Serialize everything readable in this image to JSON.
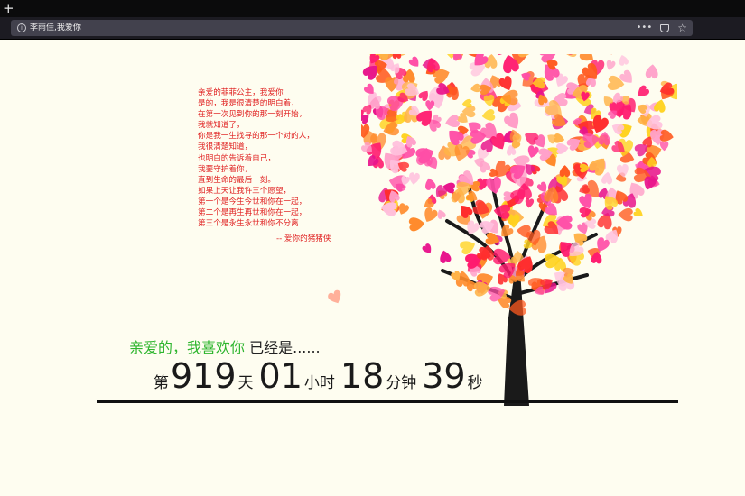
{
  "browser": {
    "new_tab_icon": "plus-icon",
    "url": "李雨佳,我爱你",
    "icons": [
      "info-icon",
      "more-dots-icon",
      "pocket-icon",
      "star-icon"
    ]
  },
  "poem": {
    "lines": [
      "亲爱的菲菲公主，我爱你",
      "是的，我是很清楚的明白着，",
      "在第一次见到你的那一刻开始，",
      "我就知道了，",
      "你是我一生找寻的那一个对的人，",
      "我很清楚知道，",
      "也明白的告诉着自己，",
      "我要守护着你，",
      "直到生命的最后一刻。",
      "如果上天让我许三个愿望，",
      "第一个是今生今世和你在一起，",
      "第二个是再生再世和你在一起，",
      "第三个是永生永世和你不分离"
    ],
    "signature": "-- 爱你的猪猪侠",
    "color": "#e02020"
  },
  "greeting": {
    "green_text": "亲爱的，我喜欢你",
    "rest_text": "已经是......",
    "green_color": "#2db52d"
  },
  "counter": {
    "prefix": "第",
    "days": "919",
    "days_label": "天",
    "hours": "01",
    "hours_label": "小时",
    "minutes": "18",
    "minutes_label": "分钟",
    "seconds": "39",
    "seconds_label": "秒"
  },
  "tree": {
    "heart_colors": [
      "#ff1a6e",
      "#ff4da6",
      "#ff8a2a",
      "#ffd21f",
      "#ff5a1f",
      "#ff9ec8",
      "#e8148c",
      "#ffb347",
      "#ff2d2d",
      "#ffc0dd"
    ]
  }
}
